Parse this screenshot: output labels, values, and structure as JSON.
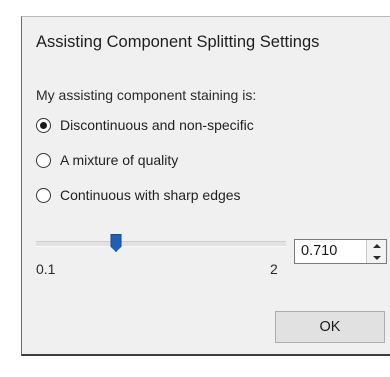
{
  "dialog": {
    "title": "Assisting Component Splitting Settings",
    "prompt": "My assisting component staining is:",
    "options": [
      {
        "label": "Discontinuous and non-specific",
        "checked": true
      },
      {
        "label": "A mixture of quality",
        "checked": false
      },
      {
        "label": "Continuous with sharp edges",
        "checked": false
      }
    ],
    "slider": {
      "min_label": "0.1",
      "max_label": "2",
      "level_fraction": 0.32
    },
    "spinbox": {
      "value": "0.710"
    },
    "ok_label": "OK"
  },
  "colors": {
    "dialog_background": "#f0f0f0",
    "slider_thumb": "#1f5fb8",
    "button_face": "#e1e1e1"
  }
}
